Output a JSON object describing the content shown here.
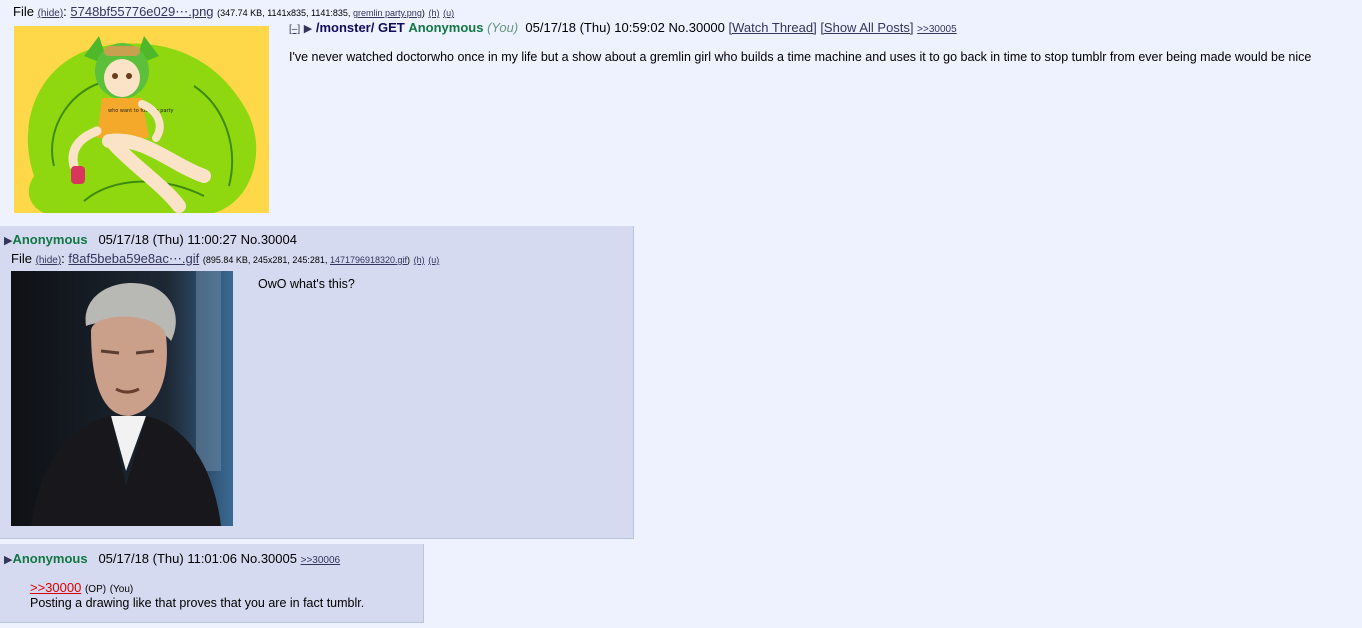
{
  "op": {
    "file_label": "File",
    "hide_label": "(hide)",
    "file_name": "5748bf55776e029⋯.png",
    "file_meta": "(347.74 KB, 1141x835, 1141:835,",
    "orig_name": "gremlin party.png",
    "meta_close": ")",
    "h_link": "(h)",
    "u_link": "(u)",
    "toggle": "[–]",
    "subject": "/monster/ GET",
    "name": "Anonymous",
    "you": "(You)",
    "date": "05/17/18 (Thu) 10:59:02",
    "number": "No.30000",
    "watch": "[Watch Thread]",
    "show_all": "[Show All Posts]",
    "backlink": ">>30005",
    "body": "I've never watched doctorwho once in my life but a show about a gremlin girl who builds a time machine and uses it to go back in time to stop tumblr from ever being made would be nice",
    "shirt_text": "who want to fucking party"
  },
  "reply1": {
    "name": "Anonymous",
    "date": "05/17/18 (Thu) 11:00:27",
    "number": "No.30004",
    "file_label": "File",
    "hide_label": "(hide)",
    "file_name": "f8af5beba59e8ac⋯.gif",
    "file_meta": "(895.84 KB, 245x281, 245:281,",
    "orig_name": "1471796918320.gif",
    "meta_close": ")",
    "h_link": "(h)",
    "u_link": "(u)",
    "body": "OwO what's this?"
  },
  "reply2": {
    "name": "Anonymous",
    "date": "05/17/18 (Thu) 11:01:06",
    "number": "No.30005",
    "backlink": ">>30006",
    "quote": ">>30000",
    "op_mark": "(OP)",
    "you_mark": "(You)",
    "body": "Posting a drawing like that proves that you are in fact tumblr."
  },
  "colors": {
    "background": "#eef2ff",
    "reply_bg": "#d6daf0",
    "name_green": "#117743",
    "link": "#34345c",
    "quote_red": "#dd0000"
  }
}
